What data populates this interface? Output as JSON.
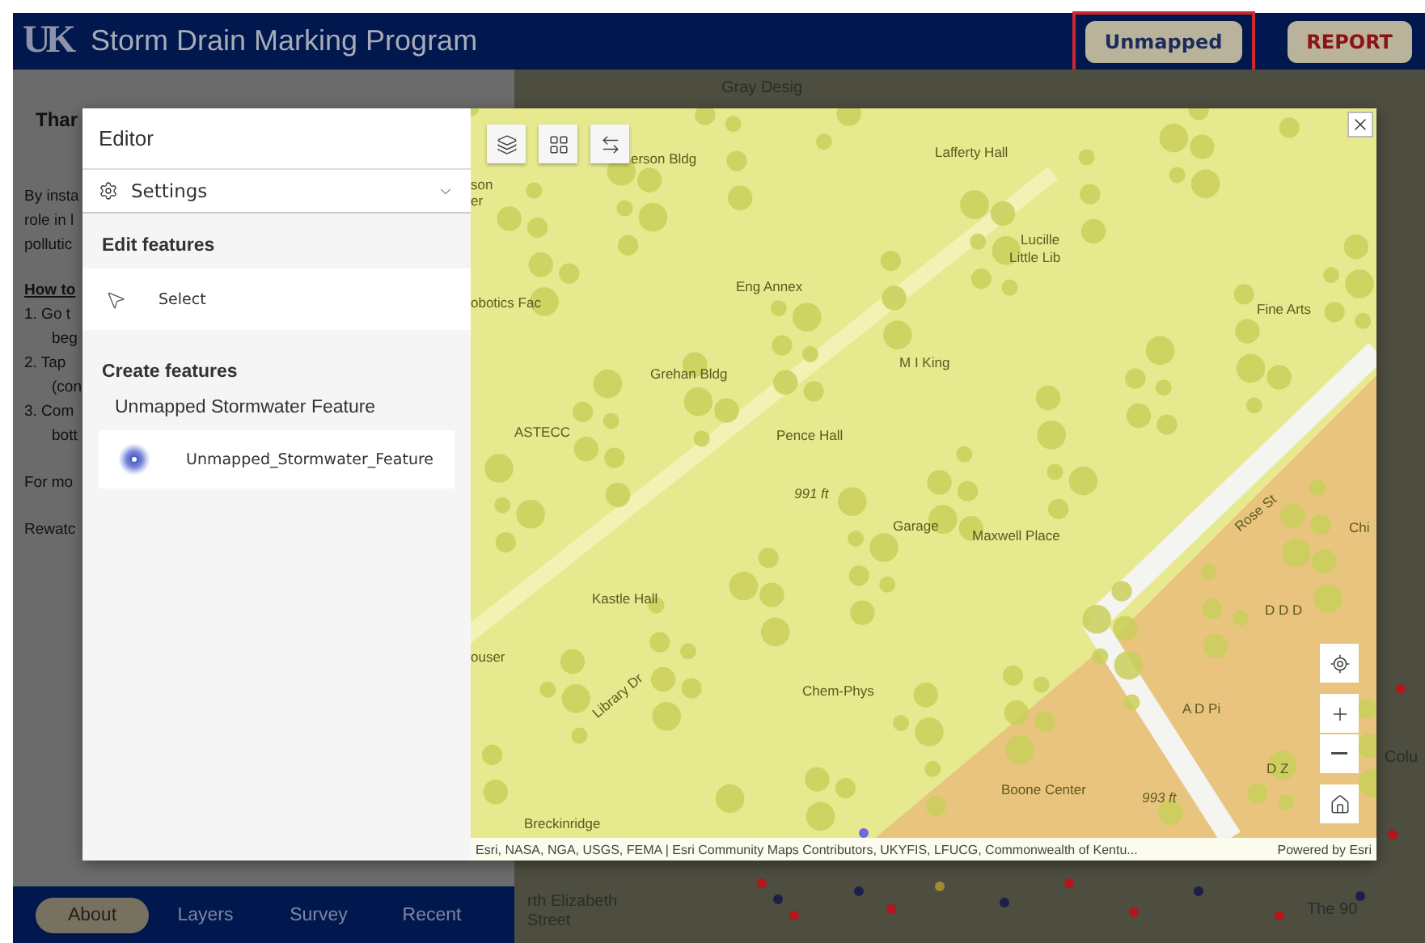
{
  "header": {
    "logo": "UK",
    "title": "Storm Drain Marking Program",
    "buttons": [
      {
        "label": "Unmapped",
        "kind": "primary",
        "highlighted": true
      },
      {
        "label": "REPORT",
        "kind": "report",
        "highlighted": false
      }
    ]
  },
  "background_text": [
    {
      "text": "Thar",
      "kind": "heading"
    },
    {
      "text": "By insta",
      "kind": "line"
    },
    {
      "text": "role in l",
      "kind": "line"
    },
    {
      "text": "pollutic",
      "kind": "line"
    },
    {
      "text": "How to",
      "kind": "subheading"
    },
    {
      "text": "1. Go t",
      "kind": "line"
    },
    {
      "text": "beg",
      "kind": "indent"
    },
    {
      "text": "2. Tap",
      "kind": "line"
    },
    {
      "text": "(con",
      "kind": "indent"
    },
    {
      "text": "3. Com",
      "kind": "line"
    },
    {
      "text": "bott",
      "kind": "indent"
    },
    {
      "text": "For mo",
      "kind": "para"
    },
    {
      "text": "Rewatc",
      "kind": "para"
    }
  ],
  "background_map_labels": [
    "Gray Desig",
    "rth Elizabeth",
    "Street",
    "The 90",
    "Colu"
  ],
  "bottom_nav": [
    {
      "label": "About",
      "selected": true
    },
    {
      "label": "Layers",
      "selected": false
    },
    {
      "label": "Survey",
      "selected": false
    },
    {
      "label": "Recent",
      "selected": false
    }
  ],
  "editor": {
    "title": "Editor",
    "settings": {
      "label": "Settings",
      "expanded": false
    },
    "edit_section": "Edit features",
    "select_tool": "Select",
    "create_section": "Create features",
    "feature_group": "Unmapped Stormwater Feature",
    "feature_template": "Unmapped_Stormwater_Feature"
  },
  "map": {
    "labels": [
      {
        "text": "erson Bldg"
      },
      {
        "text": "Lafferty Hall"
      },
      {
        "text": "son"
      },
      {
        "text": "er"
      },
      {
        "text": "Lucille"
      },
      {
        "text": "Little Lib"
      },
      {
        "text": "Eng Annex"
      },
      {
        "text": "obotics Fac"
      },
      {
        "text": "Fine Arts"
      },
      {
        "text": "M I King"
      },
      {
        "text": "Grehan Bldg"
      },
      {
        "text": "ASTECC"
      },
      {
        "text": "Pence Hall"
      },
      {
        "text": "991 ft"
      },
      {
        "text": "Garage"
      },
      {
        "text": "Maxwell Place"
      },
      {
        "text": "Rose St"
      },
      {
        "text": "Chi"
      },
      {
        "text": "D D D"
      },
      {
        "text": "Kastle Hall"
      },
      {
        "text": "ouser"
      },
      {
        "text": "Library Dr"
      },
      {
        "text": "Chem-Phys"
      },
      {
        "text": "A D Pi"
      },
      {
        "text": "D Z"
      },
      {
        "text": "Boone Center"
      },
      {
        "text": "993 ft"
      },
      {
        "text": "Breckinridge"
      }
    ],
    "attribution": "Esri, NASA, NGA, USGS, FEMA | Esri Community Maps Contributors, UKYFIS, LFUCG, Commonwealth of Kentu...",
    "powered_by": "Powered by Esri"
  }
}
